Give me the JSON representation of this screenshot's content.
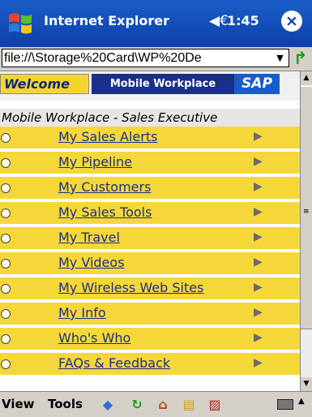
{
  "titlebar": {
    "app_title": "Internet Explorer",
    "time": "1:45",
    "speaker_icon": "◀€",
    "close_glyph": "×",
    "start_icon": "windows-flag-icon"
  },
  "addressbar": {
    "url": "file://\\Storage%20Card\\WP%20De",
    "dropdown_glyph": "▼",
    "go_glyph": "↱"
  },
  "banner": {
    "welcome_label": "Welcome",
    "product_label": "Mobile Workplace",
    "logo_text": "SAP"
  },
  "page": {
    "subtitle": "Mobile Workplace - Sales Executive"
  },
  "menu": {
    "items": [
      {
        "label": "My Sales Alerts"
      },
      {
        "label": "My Pipeline"
      },
      {
        "label": "My Customers"
      },
      {
        "label": "My Sales Tools"
      },
      {
        "label": "My Travel"
      },
      {
        "label": "My Videos"
      },
      {
        "label": "My Wireless Web Sites"
      },
      {
        "label": "My Info"
      },
      {
        "label": "Who's Who"
      },
      {
        "label": "FAQs & Feedback"
      }
    ],
    "arrow_glyph": "▶"
  },
  "scrollbar": {
    "up_glyph": "▲",
    "down_glyph": "▼",
    "grip_glyph": "≡"
  },
  "commandbar": {
    "view_label": "View",
    "tools_label": "Tools",
    "back_glyph": "◆",
    "refresh_glyph": "↻",
    "home_glyph": "⌂",
    "favorites_glyph": "▤",
    "scale_glyph": "▨",
    "keyboard_up_glyph": "▲"
  },
  "colors": {
    "titlebar": "#0d3fa8",
    "menu_row": "#f5d73a",
    "link_text": "#1b2f85",
    "sap_blue": "#1a5cc8"
  }
}
